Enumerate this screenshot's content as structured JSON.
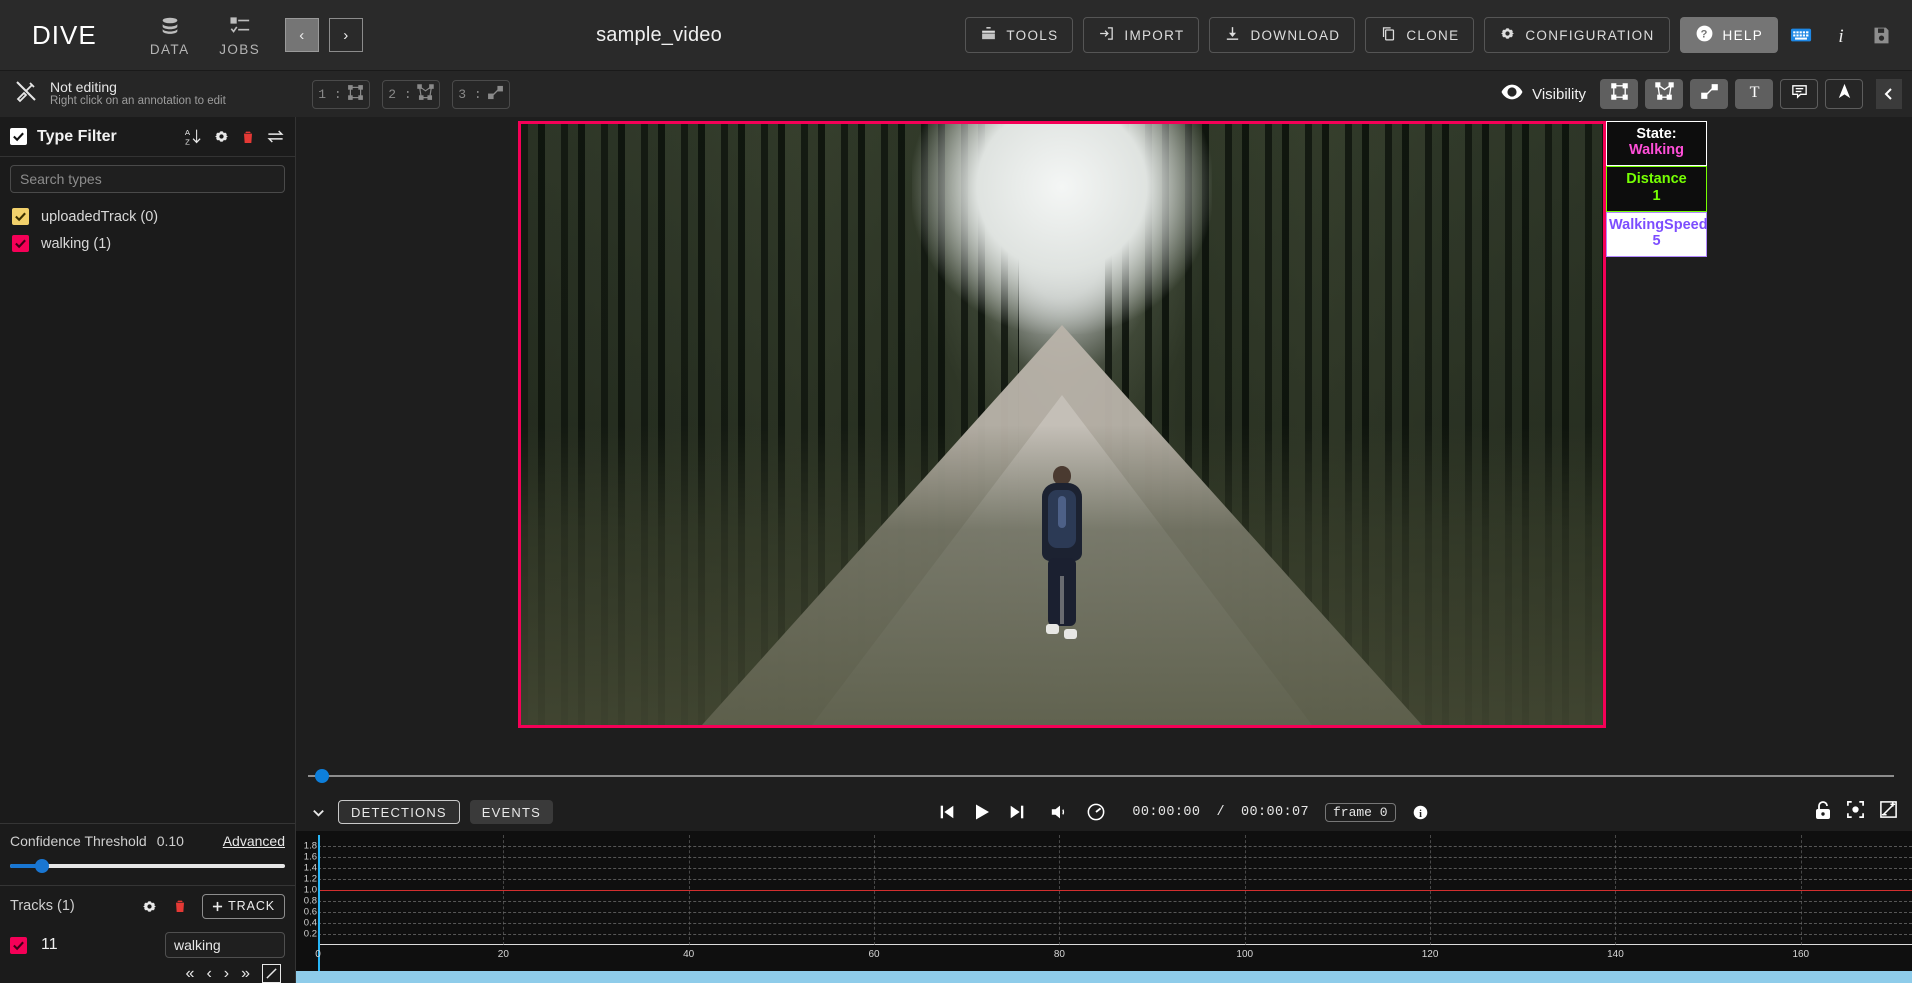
{
  "app": {
    "brand": "DIVE",
    "nav": [
      {
        "label": "DATA",
        "icon": "database-icon"
      },
      {
        "label": "JOBS",
        "icon": "jobs-list-icon"
      }
    ],
    "prev_label": "‹",
    "next_label": "›",
    "video_title": "sample_video",
    "toolbar": [
      {
        "label": "TOOLS",
        "icon": "toolbox-icon"
      },
      {
        "label": "IMPORT",
        "icon": "import-icon"
      },
      {
        "label": "DOWNLOAD",
        "icon": "download-icon"
      },
      {
        "label": "CLONE",
        "icon": "clone-icon"
      },
      {
        "label": "CONFIGURATION",
        "icon": "gear-icon"
      },
      {
        "label": "HELP",
        "icon": "help-circle-icon"
      }
    ],
    "right_icons": [
      {
        "name": "keyboard-icon"
      },
      {
        "name": "info-italic-icon"
      },
      {
        "name": "save-disk-icon"
      }
    ]
  },
  "editbar": {
    "state_title": "Not editing",
    "state_hint": "Right click on an annotation to edit",
    "modes": [
      {
        "label": "1 :",
        "icon": "rectangle-icon"
      },
      {
        "label": "2 :",
        "icon": "polygon-icon"
      },
      {
        "label": "3 :",
        "icon": "line-icon"
      }
    ],
    "visibility_label": "Visibility",
    "visibility_buttons": [
      {
        "name": "rectangle-visibility-icon",
        "style": "filled"
      },
      {
        "name": "polygon-visibility-icon",
        "style": "filled"
      },
      {
        "name": "line-visibility-icon",
        "style": "filled"
      },
      {
        "name": "text-visibility-icon",
        "style": "filled"
      },
      {
        "name": "tooltip-visibility-icon",
        "style": "outline"
      },
      {
        "name": "arrow-visibility-icon",
        "style": "outline"
      }
    ],
    "collapse_label": "‹"
  },
  "sidebar": {
    "type_filter": {
      "title": "Type Filter",
      "checked": true,
      "actions": [
        {
          "name": "sort-az-icon"
        },
        {
          "name": "gear-icon"
        },
        {
          "name": "trash-icon"
        },
        {
          "name": "swap-arrows-icon"
        }
      ],
      "search_placeholder": "Search types",
      "search_value": "",
      "types": [
        {
          "label": "uploadedTrack (0)",
          "color": "#F2D16B",
          "checked": true
        },
        {
          "label": "walking (1)",
          "color": "#F50057",
          "checked": true
        }
      ]
    },
    "confidence": {
      "label": "Confidence Threshold",
      "value": "0.10",
      "advanced_label": "Advanced"
    },
    "tracks": {
      "title": "Tracks (1)",
      "add_label": "TRACK",
      "actions": [
        {
          "name": "gear-icon"
        },
        {
          "name": "trash-icon"
        }
      ],
      "rows": [
        {
          "id": "11",
          "name": "walking",
          "color": "#F50057",
          "checked": true
        }
      ],
      "nav": [
        {
          "name": "first-frame-icon",
          "label": "«"
        },
        {
          "name": "prev-frame-icon",
          "label": "‹"
        },
        {
          "name": "next-frame-icon",
          "label": "›"
        },
        {
          "name": "last-frame-icon",
          "label": "»"
        },
        {
          "name": "edit-track-icon",
          "label": "↗"
        }
      ]
    }
  },
  "annotation": {
    "box_color": "#F50057",
    "attributes": [
      {
        "key": "State:",
        "value": "Walking",
        "border": "#FFFFFF",
        "key_color": "#FFFFFF",
        "value_color": "#FF4FD8",
        "background": "#0d0d0d"
      },
      {
        "key": "Distance",
        "value": "1",
        "border": "#76FF03",
        "key_color": "#76FF03",
        "value_color": "#76FF03",
        "background": "#0d0d0d"
      },
      {
        "key": "WalkingSpeed",
        "value": "5",
        "border": "#B388FF",
        "key_color": "#7C4DFF",
        "value_color": "#7C4DFF",
        "background": "#FFFFFF"
      }
    ]
  },
  "player": {
    "tabs": [
      {
        "label": "DETECTIONS",
        "active": true
      },
      {
        "label": "EVENTS",
        "active": false
      }
    ],
    "controls": [
      {
        "name": "prev-frame-button"
      },
      {
        "name": "play-button"
      },
      {
        "name": "next-frame-button"
      },
      {
        "name": "volume-button"
      },
      {
        "name": "playback-speed-button"
      }
    ],
    "current_time": "00:00:00",
    "separator": "/",
    "duration": "00:00:07",
    "frame_label": "frame 0",
    "info_icon": "info-icon",
    "right_buttons": [
      {
        "name": "lock-icon"
      },
      {
        "name": "center-focus-icon"
      },
      {
        "name": "zoom-fit-icon"
      }
    ]
  },
  "chart_data": {
    "type": "line",
    "title": "",
    "xlabel": "",
    "ylabel": "",
    "xlim": [
      0,
      172
    ],
    "ylim": [
      0,
      2.0
    ],
    "xticks": [
      0,
      20,
      40,
      60,
      80,
      100,
      120,
      140,
      160
    ],
    "yticks": [
      0.2,
      0.4,
      0.6,
      0.8,
      1.0,
      1.2,
      1.4,
      1.6,
      1.8
    ],
    "grid": true,
    "legend": "none",
    "series": [
      {
        "name": "track-11-detections",
        "color": "#D32F2F",
        "x": [
          0,
          172
        ],
        "values": [
          1.0,
          1.0
        ]
      }
    ],
    "cursor_x": 0,
    "cursor_color": "#29B6F6"
  }
}
